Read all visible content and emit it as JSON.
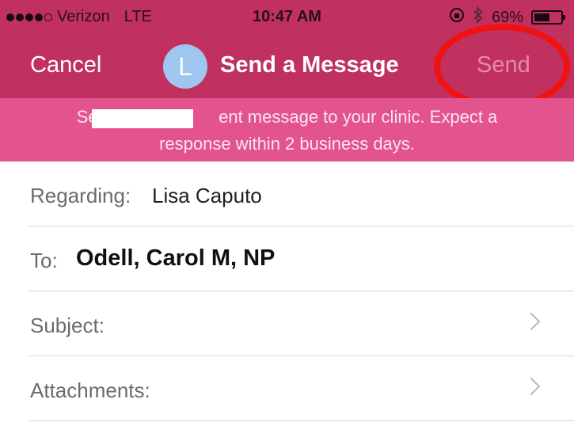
{
  "status_bar": {
    "carrier": "Verizon",
    "network": "LTE",
    "time": "10:47 AM",
    "battery": "69%",
    "battery_level": 0.69
  },
  "nav": {
    "cancel_label": "Cancel",
    "avatar_initial": "L",
    "title": "Send a Message",
    "send_label": "Send"
  },
  "banner": {
    "line1_left": "Send",
    "line1_right": "ent message to your clinic. Expect a",
    "line2": "response within 2 business days."
  },
  "form": {
    "regarding_label": "Regarding:",
    "regarding_value": "Lisa Caputo",
    "to_label": "To:",
    "to_value": "Odell, Carol M, NP",
    "subject_label": "Subject:",
    "attachments_label": "Attachments:"
  },
  "colors": {
    "header": "#c1315f",
    "banner": "#e3548f",
    "send_disabled": "#e48aa8",
    "avatar": "#9fc6ee",
    "annotation": "#ee1212"
  }
}
